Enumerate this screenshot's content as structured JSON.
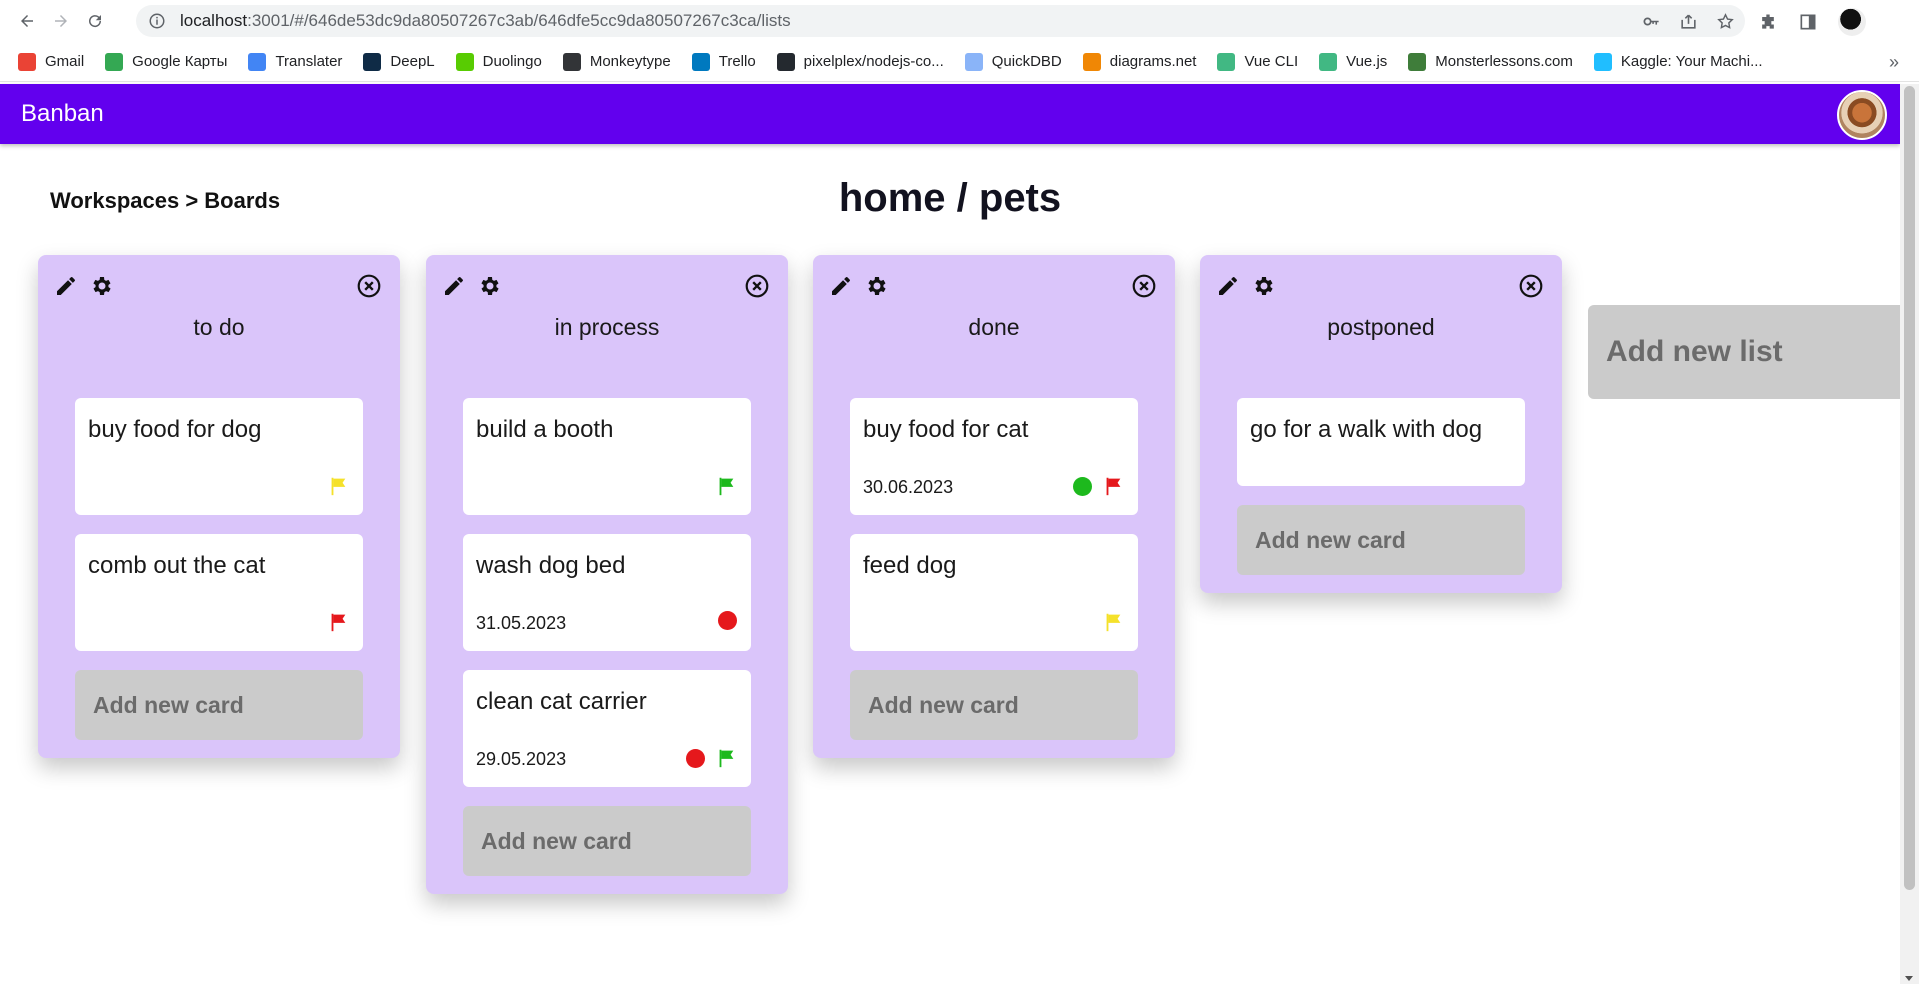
{
  "browser": {
    "url_host": "localhost",
    "url_path": ":3001/#/646de53dc9da80507267c3ab/646dfe5cc9da80507267c3ca/lists",
    "bookmarks": [
      {
        "label": "Gmail",
        "icon": "gmail-icon",
        "color": "#ea4335"
      },
      {
        "label": "Google Карты",
        "icon": "google-maps-icon",
        "color": "#34a853"
      },
      {
        "label": "Translater",
        "icon": "translate-icon",
        "color": "#4285f4"
      },
      {
        "label": "DeepL",
        "icon": "deepl-icon",
        "color": "#0f2b46"
      },
      {
        "label": "Duolingo",
        "icon": "duolingo-icon",
        "color": "#58cc02"
      },
      {
        "label": "Monkeytype",
        "icon": "monkeytype-icon",
        "color": "#323437"
      },
      {
        "label": "Trello",
        "icon": "trello-icon",
        "color": "#0079bf"
      },
      {
        "label": "pixelplex/nodejs-co...",
        "icon": "github-icon",
        "color": "#24292f"
      },
      {
        "label": "QuickDBD",
        "icon": "quickdbd-icon",
        "color": "#8ab4f8"
      },
      {
        "label": "diagrams.net",
        "icon": "diagrams-icon",
        "color": "#f08705"
      },
      {
        "label": "Vue CLI",
        "icon": "vue-icon",
        "color": "#41b883"
      },
      {
        "label": "Vue.js",
        "icon": "vue-icon",
        "color": "#41b883"
      },
      {
        "label": "Monsterlessons.com",
        "icon": "monsterlessons-icon",
        "color": "#3f7d3a"
      },
      {
        "label": "Kaggle: Your Machi...",
        "icon": "kaggle-icon",
        "color": "#20beff"
      }
    ],
    "more_label": "»"
  },
  "app": {
    "title": "Banban",
    "header_color": "#6200ee"
  },
  "page": {
    "breadcrumb": "Workspaces > Boards",
    "board_title": "home / pets",
    "add_list_label": "Add new list"
  },
  "lists": [
    {
      "title": "to do",
      "add_card_label": "Add new card",
      "cards": [
        {
          "title": "buy food for dog",
          "date": "",
          "status_dot": "",
          "flag": "#f5e12a"
        },
        {
          "title": "comb out the cat",
          "date": "",
          "status_dot": "",
          "flag": "#e5181c"
        }
      ]
    },
    {
      "title": "in process",
      "add_card_label": "Add new card",
      "cards": [
        {
          "title": "build a booth",
          "date": "",
          "status_dot": "",
          "flag": "#1db91d"
        },
        {
          "title": "wash dog bed",
          "date": "31.05.2023",
          "status_dot": "#e5181c",
          "flag": ""
        },
        {
          "title": "clean cat carrier",
          "date": "29.05.2023",
          "status_dot": "#e5181c",
          "flag": "#1db91d"
        }
      ]
    },
    {
      "title": "done",
      "add_card_label": "Add new card",
      "cards": [
        {
          "title": "buy food for cat",
          "date": "30.06.2023",
          "status_dot": "#1db91d",
          "flag": "#e5181c"
        },
        {
          "title": "feed dog",
          "date": "",
          "status_dot": "",
          "flag": "#f5e12a"
        }
      ]
    },
    {
      "title": "postponed",
      "add_card_label": "Add new card",
      "cards": [
        {
          "title": "go for a walk with dog",
          "date": "",
          "status_dot": "",
          "flag": ""
        }
      ]
    }
  ],
  "list_color": "#dac5fa"
}
